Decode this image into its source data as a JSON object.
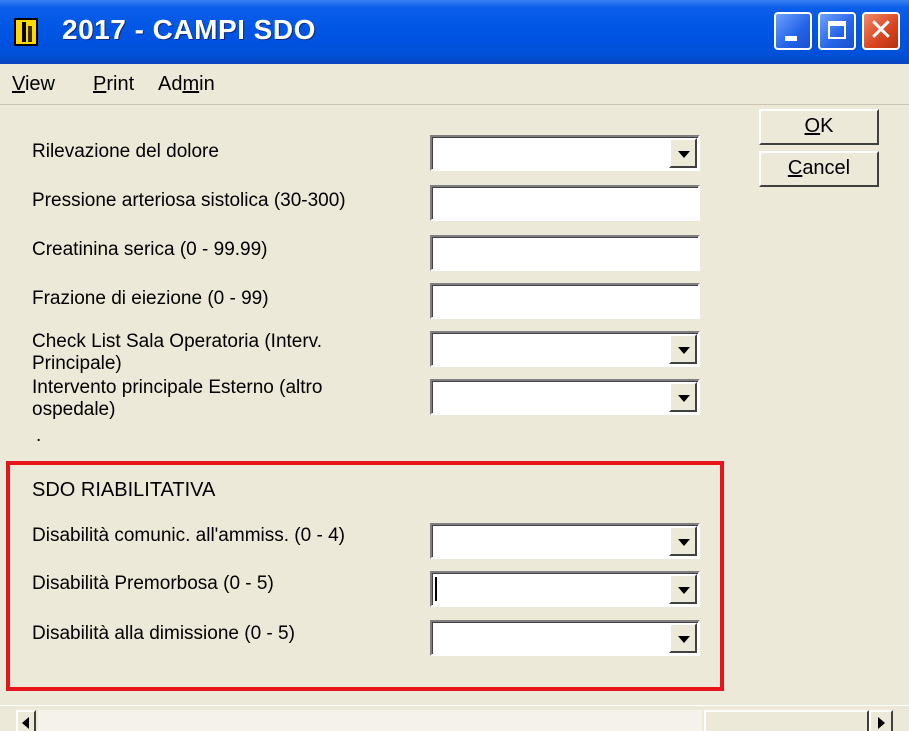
{
  "window": {
    "title": "2017 - CAMPI SDO",
    "controls": [
      "minimize",
      "maximize",
      "close"
    ],
    "close_glyph": "✕"
  },
  "menu": {
    "items": [
      {
        "label": "View",
        "accel": "V",
        "rest": "iew"
      },
      {
        "label": "Print",
        "accel": "P",
        "rest": "rint"
      },
      {
        "label": "Admin",
        "accel": "m",
        "pre": "Ad",
        "rest": "in"
      }
    ]
  },
  "buttons": {
    "ok": {
      "label": "OK",
      "accel": "O",
      "rest": "K"
    },
    "cancel": {
      "label": "Cancel",
      "accel": "C",
      "rest": "ancel"
    }
  },
  "fields": [
    {
      "label": "Rilevazione del dolore",
      "type": "combo",
      "value": ""
    },
    {
      "label": "Pressione arteriosa sistolica (30-300)",
      "type": "text",
      "value": ""
    },
    {
      "label": "Creatinina serica (0 - 99.99)",
      "type": "text",
      "value": ""
    },
    {
      "label": "Frazione di eiezione (0 - 99)",
      "type": "text",
      "value": ""
    },
    {
      "label": "Check List Sala Operatoria (Interv. Principale)",
      "label_lines": [
        "Check List Sala Operatoria (Interv.",
        "Principale)"
      ],
      "type": "combo",
      "value": ""
    },
    {
      "label": "Intervento principale Esterno (altro ospedale)",
      "label_lines": [
        "Intervento principale Esterno (altro",
        "ospedale)"
      ],
      "type": "combo",
      "value": ""
    }
  ],
  "stray_dot": ".",
  "rehab_section": {
    "title": "SDO RIABILITATIVA",
    "highlight_color": "#E8141B",
    "fields": [
      {
        "label": "Disabilità comunic. all'ammiss. (0 - 4)",
        "type": "combo",
        "value": ""
      },
      {
        "label": "Disabilità Premorbosa (0 - 5)",
        "type": "combo",
        "value": "",
        "focused": true
      },
      {
        "label": "Disabilità alla dimissione (0 - 5)",
        "type": "combo",
        "value": ""
      }
    ]
  },
  "colors": {
    "titlebar": "#0055E5",
    "face": "#ECE9D8",
    "close_button": "#D8431E"
  }
}
